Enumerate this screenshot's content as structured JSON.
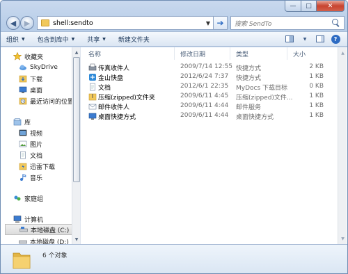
{
  "toolbar": {
    "address": "shell:sendto",
    "search_placeholder": "搜索 SendTo",
    "commands": [
      "组织",
      "包含到库中",
      "共享",
      "新建文件夹"
    ]
  },
  "navigation": {
    "favorites_header": "收藏夹",
    "favorites": [
      "SkyDrive",
      "下载",
      "桌面",
      "最近访问的位置"
    ],
    "libraries_header": "库",
    "libraries": [
      "视频",
      "图片",
      "文档",
      "迅雷下载",
      "音乐"
    ],
    "homegroup": "家庭组",
    "computer_header": "计算机",
    "drives": [
      "本地磁盘 (C:)",
      "本地磁盘 (D:)"
    ]
  },
  "columns": [
    "名称",
    "修改日期",
    "类型",
    "大小"
  ],
  "files": [
    {
      "name": "传真收件人",
      "date": "2009/7/14 12:55",
      "type": "快捷方式",
      "size": "2 KB",
      "icon": "fax-icon"
    },
    {
      "name": "金山快盘",
      "date": "2012/6/24 7:37",
      "type": "快捷方式",
      "size": "1 KB",
      "icon": "kuaipan-icon"
    },
    {
      "name": "文档",
      "date": "2012/6/1 22:35",
      "type": "MyDocs 下载目标",
      "size": "0 KB",
      "icon": "document-icon"
    },
    {
      "name": "压缩(zipped)文件夹",
      "date": "2009/6/11 4:45",
      "type": "压缩(zipped)文件...",
      "size": "1 KB",
      "icon": "zip-folder-icon"
    },
    {
      "name": "邮件收件人",
      "date": "2009/6/11 4:44",
      "type": "邮件服务",
      "size": "1 KB",
      "icon": "mail-icon"
    },
    {
      "name": "桌面快捷方式",
      "date": "2009/6/11 4:44",
      "type": "桌面快捷方式",
      "size": "1 KB",
      "icon": "desktop-icon"
    }
  ],
  "status": {
    "item_count": "6 个对象"
  },
  "colors": {
    "frame": "#b7cde8",
    "folder": "#f1c85a",
    "accent": "#2e6cc3"
  }
}
